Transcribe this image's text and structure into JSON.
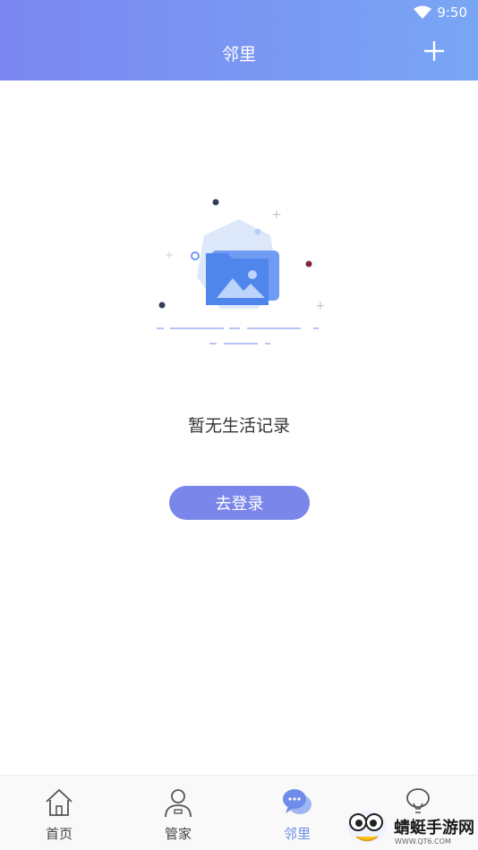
{
  "status_bar": {
    "time": "9:50",
    "wifi_icon": "wifi-icon"
  },
  "header": {
    "title": "邻里",
    "add_icon": "plus-icon"
  },
  "empty_state": {
    "message": "暂无生活记录",
    "illustration_icon": "folder-image-icon"
  },
  "login_button": {
    "label": "去登录"
  },
  "tabbar": {
    "tabs": [
      {
        "label": "首页",
        "icon": "home-icon",
        "active": false
      },
      {
        "label": "管家",
        "icon": "butler-icon",
        "active": false
      },
      {
        "label": "邻里",
        "icon": "chat-bubble-icon",
        "active": true
      },
      {
        "label": "",
        "icon": "lightbulb-icon",
        "active": false
      }
    ]
  },
  "watermark": {
    "text": "蜻蜓手游网",
    "url": "WWW.QT6.COM"
  },
  "colors": {
    "header_start": "#7b86f0",
    "header_end": "#79a6f4",
    "accent": "#7a86ea",
    "active_tab": "#6f8de8"
  }
}
